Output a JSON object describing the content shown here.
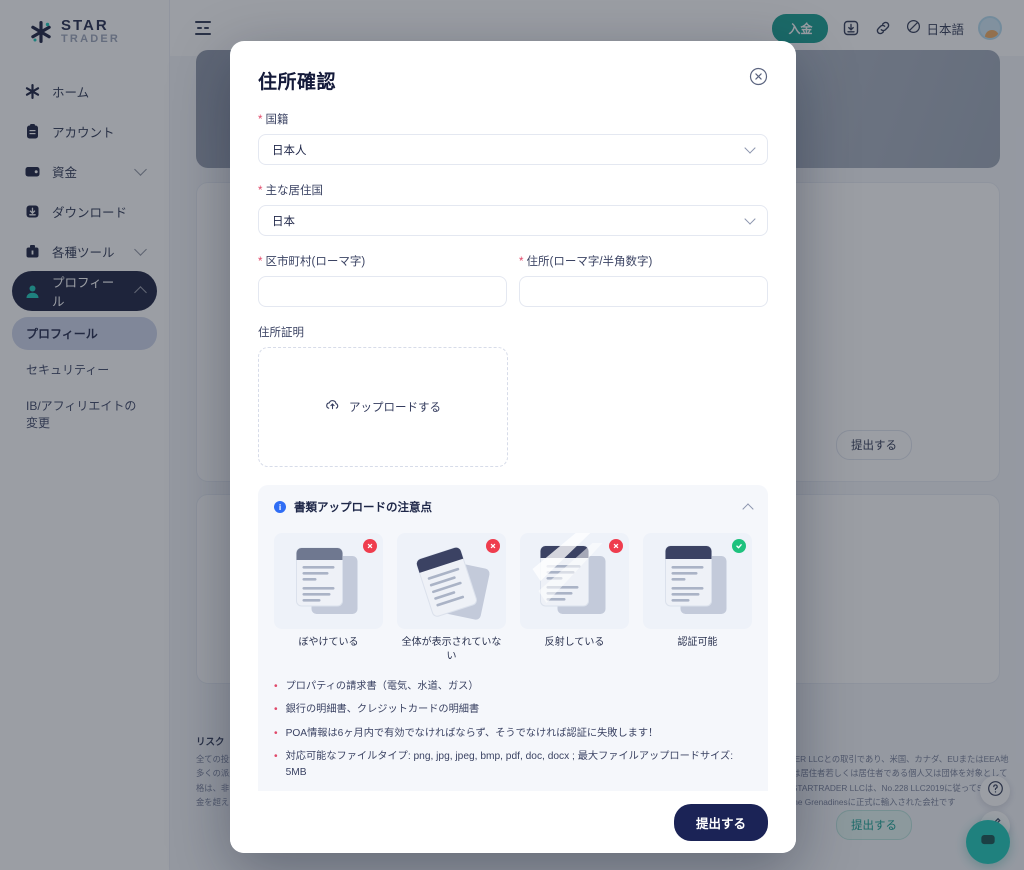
{
  "brand": {
    "line1": "STAR",
    "line2": "TRADER"
  },
  "sidebar": {
    "items": [
      {
        "label": "ホーム",
        "icon": "star-icon",
        "chevron": "none"
      },
      {
        "label": "アカウント",
        "icon": "clipboard-icon",
        "chevron": "none"
      },
      {
        "label": "資金",
        "icon": "wallet-icon",
        "chevron": "down"
      },
      {
        "label": "ダウンロード",
        "icon": "download-icon",
        "chevron": "none"
      },
      {
        "label": "各種ツール",
        "icon": "toolbox-icon",
        "chevron": "down"
      },
      {
        "label": "プロフィール",
        "icon": "user-icon",
        "chevron": "up",
        "active": true
      }
    ],
    "sub_items": [
      {
        "label": "プロフィール",
        "selected": true
      },
      {
        "label": "セキュリティー",
        "selected": false
      },
      {
        "label": "IB/アフィリエイトの変更",
        "selected": false
      }
    ]
  },
  "topbar": {
    "collapse_icon": "sidebar-collapse-icon",
    "deposit_label": "入金",
    "download_icon": "download-icon",
    "link_icon": "link-icon",
    "globe_icon": "globe-icon",
    "language": "日本語",
    "avatar": "user-avatar"
  },
  "background": {
    "submit_outline_label": "提出する",
    "submit_teal_label": "提出する",
    "disclaimer_title": "リスク",
    "disclaimer_body": "全ての投資にはリスクが伴い、極めて高い水準のリスクを伴います。多くの派生商品を借り入れることが可能です。デリバティブ商品の価格は、非常に迅速にあなたに不利に変わる可能性があり、損失が預託金を超えることとなります。過去の成果は将来の成果に対する保証とはなりません。あなたの投資目的、財務状況、経験、購入可能性を慎重に考慮する必要があります。リスク開示に記載されている全てのリスクに関する十分な知識と経験を持ち、損害を被ることが許容できる場合のみ取引してください。当ウェブサイトを通じた取引はSTARTRADER LLCとの取引であり、米国、カナダ、EUまたはEEA地域の市民又は居住者若しくは居住者である個人又は団体を対象としていません。STARTRADER LLCは、No.228 LLC2019に従ってSaint Vincent & The Grenadinesに正式に輸入された会社です",
    "fab_help_icon": "help-circle-icon",
    "fab_edit_icon": "pencil-icon",
    "fab_chat_icon": "chat-icon"
  },
  "modal": {
    "title": "住所確認",
    "close_icon": "close-circle-icon",
    "fields": {
      "nationality": {
        "label": "国籍",
        "required": true,
        "value": "日本人"
      },
      "residence": {
        "label": "主な居住国",
        "required": true,
        "value": "日本"
      },
      "city": {
        "label": "区市町村(ローマ字)",
        "required": true,
        "value": "",
        "placeholder": ""
      },
      "address": {
        "label": "住所(ローマ字/半角数字)",
        "required": true,
        "value": "",
        "placeholder": ""
      }
    },
    "upload": {
      "label": "住所証明",
      "button_label": "アップロードする",
      "icon": "upload-icon"
    },
    "info": {
      "icon": "info-icon",
      "title": "書類アップロードの注意点",
      "collapse_icon": "chevron-up-icon",
      "samples": [
        {
          "caption": "ぼやけている",
          "status": "bad"
        },
        {
          "caption": "全体が表示されていない",
          "status": "bad"
        },
        {
          "caption": "反射している",
          "status": "bad"
        },
        {
          "caption": "認証可能",
          "status": "good"
        }
      ],
      "bullets": [
        {
          "text": "プロパティの請求書（電気、水道、ガス）"
        },
        {
          "text": "銀行の明細書、クレジットカードの明細書"
        },
        {
          "text": "POA情報は6ヶ月内で有効でなければならず、そうでなければ認証に失敗します！"
        },
        {
          "text": "対応可能なファイルタイプ: png, jpg, jpeg, bmp, pdf, doc, docx ; 最大ファイルアップロードサイズ: 5MB"
        }
      ]
    },
    "submit_label": "提出する"
  },
  "colors": {
    "accent_navy": "#141a3a",
    "accent_teal": "#0f9d8f",
    "info_blue": "#2f6df5",
    "required_red": "#e0496a",
    "bad_red": "#ef3d4e",
    "good_green": "#1ec27e",
    "submit_navy": "#1b2356"
  }
}
